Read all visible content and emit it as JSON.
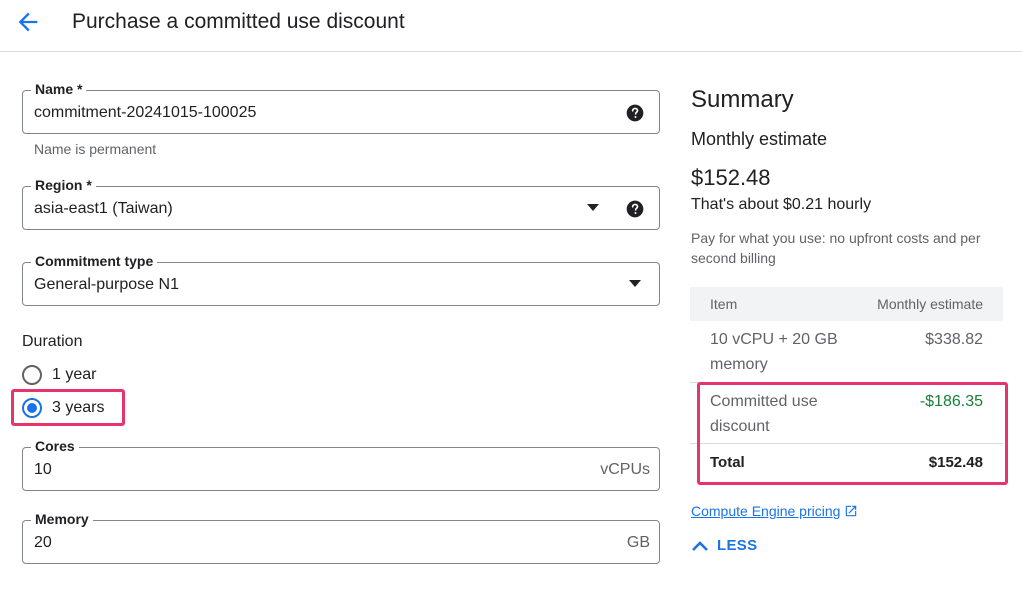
{
  "header": {
    "title": "Purchase a committed use discount",
    "back_icon": "arrow-back-icon"
  },
  "form": {
    "name": {
      "label": "Name *",
      "value": "commitment-20241015-100025",
      "hint": "Name is permanent"
    },
    "region": {
      "label": "Region *",
      "value": "asia-east1 (Taiwan)"
    },
    "commitment_type": {
      "label": "Commitment type",
      "value": "General-purpose N1"
    },
    "duration": {
      "label": "Duration",
      "options": [
        {
          "label": "1 year",
          "selected": false
        },
        {
          "label": "3 years",
          "selected": true
        }
      ]
    },
    "cores": {
      "label": "Cores",
      "value": "10",
      "suffix": "vCPUs"
    },
    "memory": {
      "label": "Memory",
      "value": "20",
      "suffix": "GB"
    }
  },
  "summary": {
    "title": "Summary",
    "monthly_label": "Monthly estimate",
    "monthly_price": "$152.48",
    "hourly": "That's about $0.21 hourly",
    "payg": "Pay for what you use: no upfront costs and per second billing",
    "table": {
      "headers": [
        "Item",
        "Monthly estimate"
      ],
      "rows": [
        {
          "item": "10 vCPU + 20 GB memory",
          "value": "$338.82"
        },
        {
          "item": "Committed use discount",
          "value": "-$186.35"
        },
        {
          "item": "Total",
          "value": "$152.48"
        }
      ]
    },
    "pricing_link": "Compute Engine pricing",
    "less_label": "LESS"
  },
  "colors": {
    "accent": "#1a73e8",
    "highlight": "#e8336d",
    "discount": "#188038"
  }
}
